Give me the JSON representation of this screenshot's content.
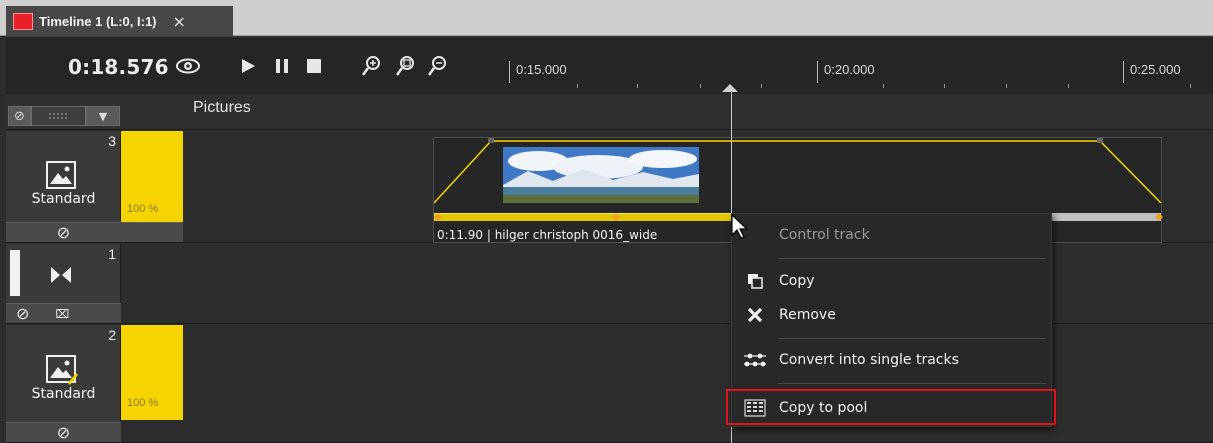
{
  "tab": {
    "title": "Timeline 1 (L:0, I:1)",
    "close": "×",
    "color": "#e8202a"
  },
  "toolbar": {
    "timecode": "0:18.576",
    "icons": [
      "eye-icon",
      "play-icon",
      "pause-icon",
      "stop-icon",
      "zoom-in-icon",
      "zoom-fit-icon",
      "zoom-out-icon"
    ]
  },
  "ruler": {
    "labels": [
      "0:15.000",
      "0:20.000",
      "0:25.000"
    ]
  },
  "header": {
    "section_label": "Pictures",
    "dropdown_arrow": "▼",
    "none_symbol": "⊘"
  },
  "tracks": [
    {
      "number": "3",
      "mode": "Standard",
      "volume_percent": "100 %",
      "volume_level": 1.0,
      "icon": "image-track-icon",
      "foot_symbol": "⊘"
    },
    {
      "number": "1",
      "mode": "",
      "icon": "transition-icon",
      "foot_symbols": [
        "⊘",
        "⌧"
      ]
    },
    {
      "number": "2",
      "mode": "Standard",
      "volume_percent": "100 %",
      "volume_level": 1.0,
      "icon": "image-edit-track-icon",
      "foot_symbol": "⊘"
    }
  ],
  "clip": {
    "label": "0:11.90 | hilger christoph 0016_wide"
  },
  "context_menu": {
    "items": [
      {
        "label": "Control track",
        "enabled": false,
        "icon": ""
      },
      {
        "label": "Copy",
        "enabled": true,
        "icon": "copy-icon"
      },
      {
        "label": "Remove",
        "enabled": true,
        "icon": "remove-icon"
      },
      {
        "label": "Convert into single tracks",
        "enabled": true,
        "icon": "convert-tracks-icon"
      },
      {
        "label": "Copy to pool",
        "enabled": true,
        "icon": "pool-icon",
        "highlighted": true
      }
    ]
  },
  "colors": {
    "accent_yellow": "#f5d400",
    "highlight_red": "#e0141c",
    "background": "#2d2d2d"
  }
}
